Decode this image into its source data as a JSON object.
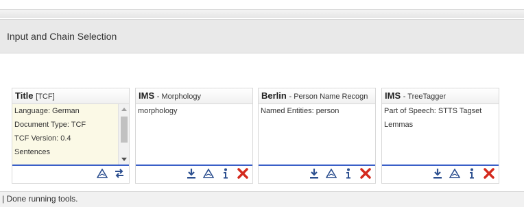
{
  "section": {
    "title": "Input and Chain Selection"
  },
  "cards": [
    {
      "name": "Title",
      "subtitle": "[TCF]",
      "lines": [
        "Language: German",
        "Document Type: TCF",
        "TCF Version: 0.4",
        "Sentences"
      ],
      "icons": [
        "warning-icon",
        "swap-icon"
      ]
    },
    {
      "name": "IMS",
      "subtitle": "- Morphology",
      "lines": [
        "morphology"
      ],
      "icons": [
        "download-icon",
        "warning-icon",
        "info-icon",
        "remove-icon"
      ]
    },
    {
      "name": "Berlin",
      "subtitle": "- Person Name Recogn",
      "lines": [
        "Named Entities: person"
      ],
      "icons": [
        "download-icon",
        "warning-icon",
        "info-icon",
        "remove-icon"
      ]
    },
    {
      "name": "IMS",
      "subtitle": "- TreeTagger",
      "lines": [
        "Part of Speech: STTS Tagset",
        "Lemmas"
      ],
      "icons": [
        "download-icon",
        "warning-icon",
        "info-icon",
        "remove-icon"
      ]
    }
  ],
  "status": {
    "text": "| Done running tools."
  },
  "colors": {
    "accent": "#3a5fc8",
    "remove": "#d42a1e",
    "icon": "#2c4f8f",
    "input_bg": "#fbf9e6"
  }
}
